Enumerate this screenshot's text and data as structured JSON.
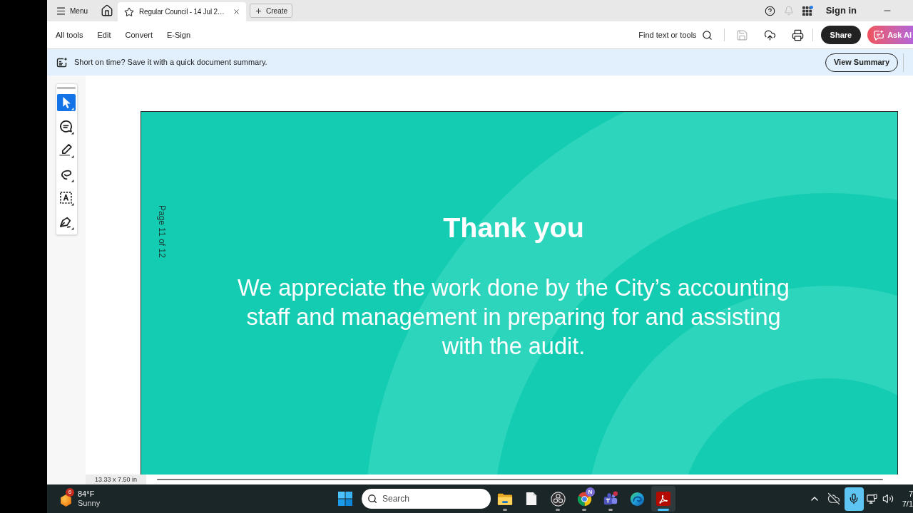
{
  "title_bar": {
    "menu": {
      "label": "Menu"
    },
    "tabs": [
      {
        "label": "Regular Council - 14 Jul 2…",
        "selected": true
      }
    ],
    "create_button": {
      "label": "Create"
    },
    "sign_in": {
      "label": "Sign in"
    }
  },
  "toolbar": {
    "menu_items": [
      {
        "label": "All tools"
      },
      {
        "label": "Edit"
      },
      {
        "label": "Convert"
      },
      {
        "label": "E-Sign"
      }
    ],
    "find_button": {
      "label": "Find text or tools"
    },
    "actions": [
      {
        "kind": "save",
        "disabled": true
      },
      {
        "kind": "upload",
        "disabled": false
      },
      {
        "kind": "print",
        "disabled": false
      }
    ],
    "share_button": {
      "label": "Share"
    },
    "ask_ai_button": {
      "label": "Ask AI"
    }
  },
  "banner": {
    "message": "Short on time? Save it with a quick document summary.",
    "button": "View Summary"
  },
  "tools": [
    {
      "kind": "select",
      "selected": true
    },
    {
      "kind": "comment",
      "selected": false
    },
    {
      "kind": "highlight",
      "selected": false
    },
    {
      "kind": "draw",
      "selected": false
    },
    {
      "kind": "text-box",
      "selected": false
    },
    {
      "kind": "sign",
      "selected": false
    }
  ],
  "document": {
    "page_label": "Page 11 of 12",
    "title": "Thank you",
    "body_lines": [
      "We appreciate the work done by the City’s accounting",
      "staff and management in preparing for and assisting",
      "with the audit."
    ],
    "page_size": "13.33 x 7.50 in"
  },
  "taskbar": {
    "weather": {
      "badge": "6",
      "temperature": "84°F",
      "condition": "Sunny"
    },
    "search": {
      "placeholder": "Search"
    },
    "apps": [
      {
        "kind": "file-explorer",
        "running": true,
        "active": false
      },
      {
        "kind": "file",
        "running": false,
        "active": false
      },
      {
        "kind": "obs",
        "running": true,
        "active": false
      },
      {
        "kind": "chrome",
        "badge": "N",
        "running": true,
        "active": false
      },
      {
        "kind": "teams",
        "running": true,
        "active": false
      },
      {
        "kind": "edge",
        "running": false,
        "active": false
      },
      {
        "kind": "acrobat",
        "running": true,
        "active": true
      }
    ],
    "tray": [
      {
        "kind": "chevron"
      },
      {
        "kind": "cloud-off"
      },
      {
        "kind": "mic"
      },
      {
        "kind": "network"
      },
      {
        "kind": "volume"
      }
    ],
    "clock": {
      "time": "7",
      "date": "7/1"
    }
  }
}
